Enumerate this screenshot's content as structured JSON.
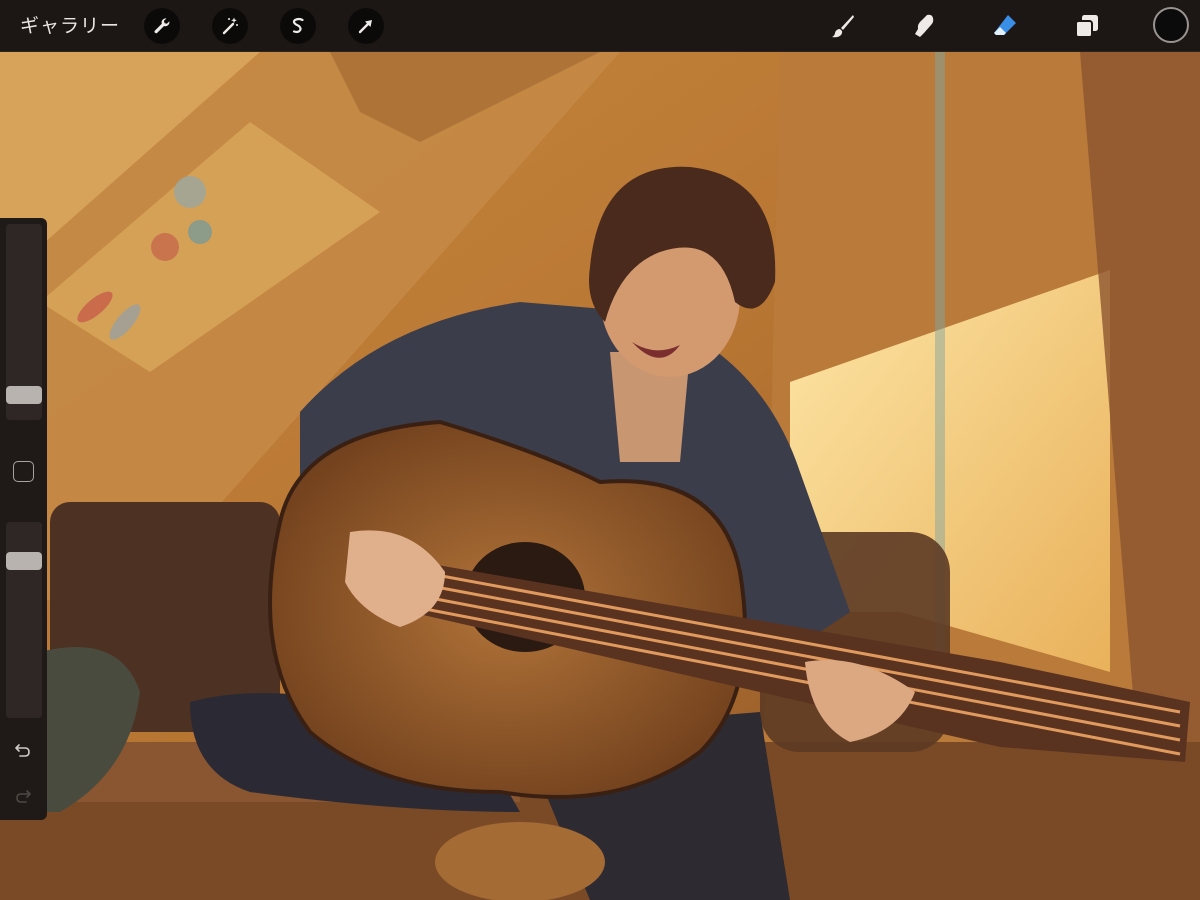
{
  "toolbar": {
    "gallery_label": "ギャラリー",
    "left_tools": [
      {
        "name": "actions-tool",
        "icon": "wrench-icon"
      },
      {
        "name": "adjustments-tool",
        "icon": "magic-wand-icon"
      },
      {
        "name": "selection-tool",
        "icon": "selection-s-icon"
      },
      {
        "name": "transform-tool",
        "icon": "arrow-cursor-icon"
      }
    ],
    "right_tools": [
      {
        "name": "brush-tool",
        "icon": "brush-icon",
        "active": false
      },
      {
        "name": "smudge-tool",
        "icon": "smudge-finger-icon",
        "active": false
      },
      {
        "name": "eraser-tool",
        "icon": "eraser-icon",
        "active": true
      },
      {
        "name": "layers-tool",
        "icon": "layers-icon",
        "active": false
      }
    ],
    "current_color": "#0b0b0b",
    "active_color": "#3a8ee6"
  },
  "sidebar": {
    "brush_size_level": 0.91,
    "opacity_level": 0.17,
    "modify_button_icon": "square-icon",
    "undo_icon": "undo-arrow-icon",
    "redo_icon": "redo-arrow-icon",
    "redo_enabled": false
  },
  "canvas": {
    "artwork": "illustration"
  }
}
